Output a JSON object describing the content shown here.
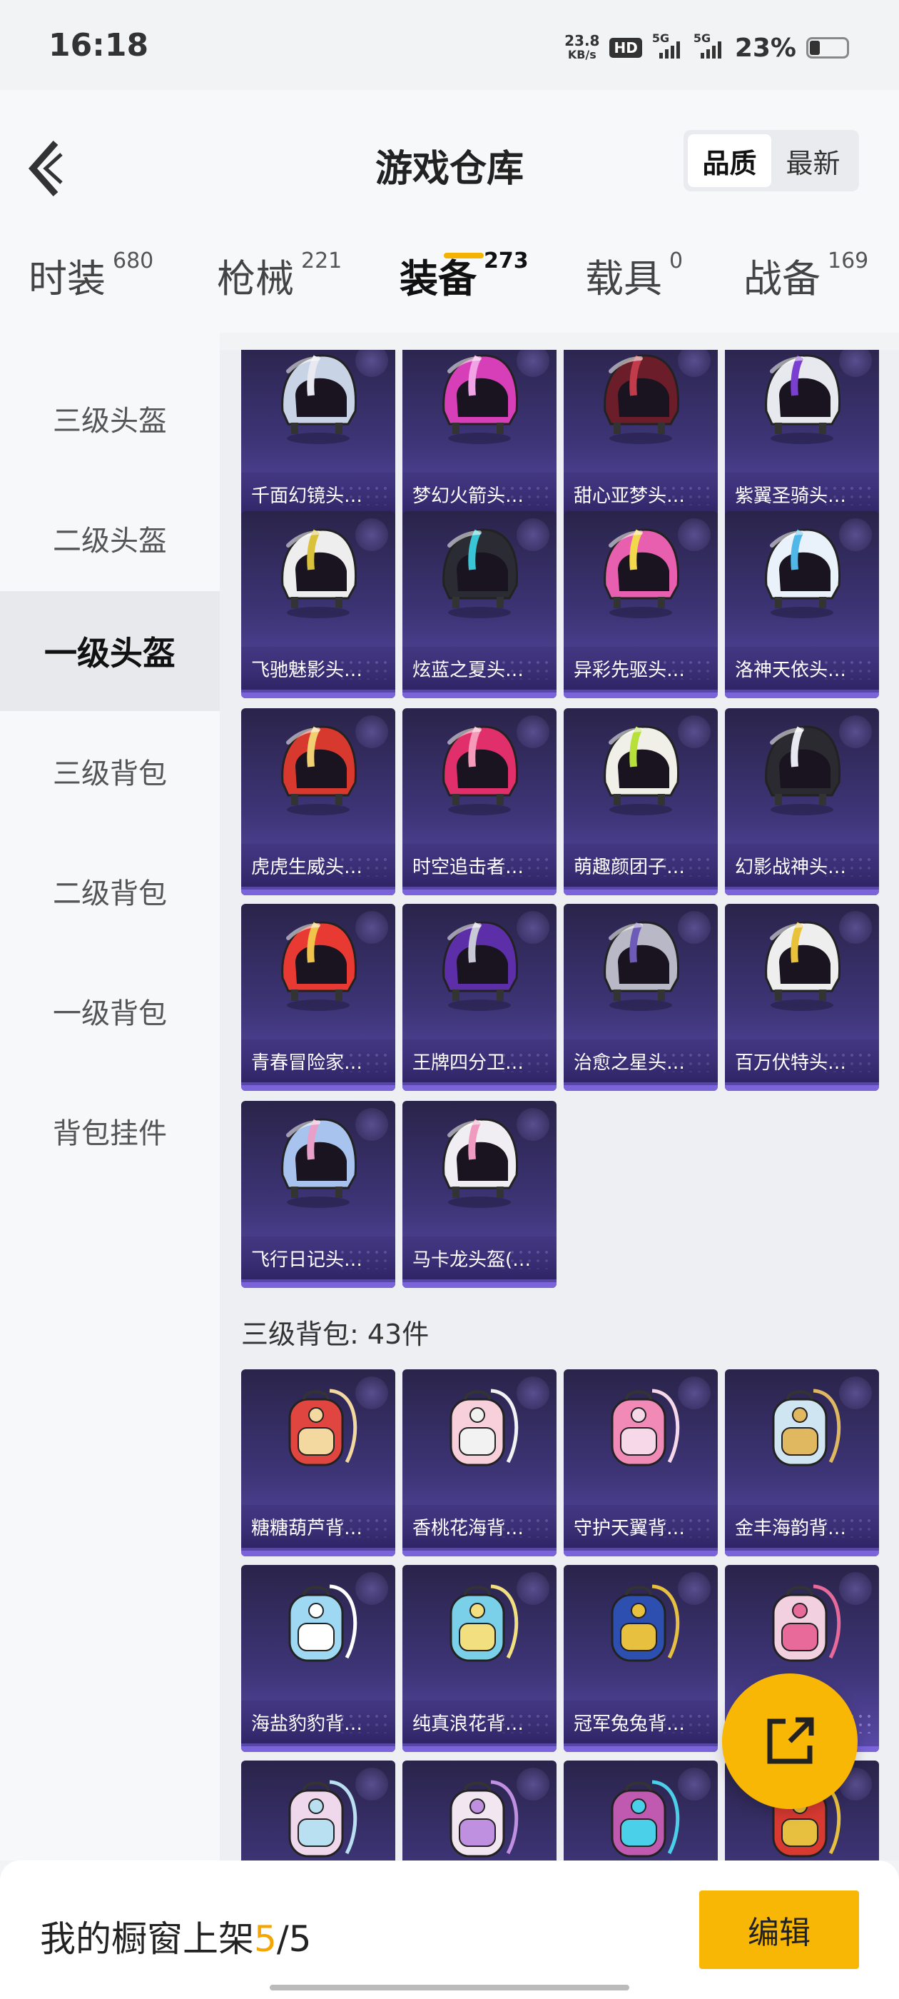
{
  "status_bar": {
    "time": "16:18",
    "net_speed_value": "23.8",
    "net_speed_unit": "KB/s",
    "hd_label": "HD",
    "signal_1": "5G",
    "signal_2": "5G",
    "battery": "23%"
  },
  "header": {
    "title": "游戏仓库",
    "sort_options": [
      {
        "label": "品质",
        "active": true
      },
      {
        "label": "最新",
        "active": false
      }
    ]
  },
  "tabs": [
    {
      "label": "时装",
      "count": "680",
      "active": false
    },
    {
      "label": "枪械",
      "count": "221",
      "active": false
    },
    {
      "label": "装备",
      "count": "273",
      "active": true
    },
    {
      "label": "载具",
      "count": "0",
      "active": false
    },
    {
      "label": "战备",
      "count": "169",
      "active": false
    }
  ],
  "sidebar": {
    "items": [
      {
        "label": "三级头盔",
        "active": false
      },
      {
        "label": "二级头盔",
        "active": false
      },
      {
        "label": "一级头盔",
        "active": true
      },
      {
        "label": "三级背包",
        "active": false
      },
      {
        "label": "二级背包",
        "active": false
      },
      {
        "label": "一级背包",
        "active": false
      },
      {
        "label": "背包挂件",
        "active": false
      }
    ]
  },
  "helmets": [
    {
      "name": "千面幻镜头…",
      "icon": "helmet-icon",
      "color": "#c9d3e6",
      "accent": "#e9e9f2"
    },
    {
      "name": "梦幻火箭头…",
      "icon": "helmet-icon",
      "color": "#d63fb7",
      "accent": "#f2a3e6"
    },
    {
      "name": "甜心亚梦头…",
      "icon": "helmet-icon",
      "color": "#6b1e2a",
      "accent": "#c23b4a"
    },
    {
      "name": "紫翼圣骑头…",
      "icon": "helmet-icon",
      "color": "#e8e8ef",
      "accent": "#7a3fd1"
    },
    {
      "name": "飞驰魅影头…",
      "icon": "helmet-icon",
      "color": "#eeeeee",
      "accent": "#d9c23a"
    },
    {
      "name": "炫蓝之夏头…",
      "icon": "helmet-icon",
      "color": "#2b2b33",
      "accent": "#38c6d6"
    },
    {
      "name": "异彩先驱头…",
      "icon": "helmet-icon",
      "color": "#e85fb0",
      "accent": "#f2d84a"
    },
    {
      "name": "洛神天依头…",
      "icon": "helmet-icon",
      "color": "#e9f2fa",
      "accent": "#4fb8e8"
    },
    {
      "name": "虎虎生威头…",
      "icon": "helmet-icon",
      "color": "#d8392f",
      "accent": "#f0d070"
    },
    {
      "name": "时空追击者…",
      "icon": "helmet-icon",
      "color": "#e02f6a",
      "accent": "#f59ab8"
    },
    {
      "name": "萌趣颜团子…",
      "icon": "helmet-icon",
      "color": "#f0f0e8",
      "accent": "#b8e03a"
    },
    {
      "name": "幻影战神头…",
      "icon": "helmet-icon",
      "color": "#2a2a30",
      "accent": "#e8e8f0"
    },
    {
      "name": "青春冒险家…",
      "icon": "helmet-icon",
      "color": "#e83a32",
      "accent": "#f2c34a"
    },
    {
      "name": "王牌四分卫…",
      "icon": "helmet-icon",
      "color": "#5c2fa8",
      "accent": "#c8c8d6"
    },
    {
      "name": "治愈之星头…",
      "icon": "helmet-icon",
      "color": "#b8b8c6",
      "accent": "#6e5ab8"
    },
    {
      "name": "百万伏特头…",
      "icon": "helmet-icon",
      "color": "#eeeeee",
      "accent": "#e8c33a"
    },
    {
      "name": "飞行日记头…",
      "icon": "helmet-icon",
      "color": "#a8c4ee",
      "accent": "#e8a0c8"
    },
    {
      "name": "马卡龙头盔(…",
      "icon": "helmet-icon",
      "color": "#f0eef2",
      "accent": "#f09ac0"
    }
  ],
  "backpack_section": {
    "label": "三级背包: 43件"
  },
  "backpacks": [
    {
      "name": "糖糖葫芦背…",
      "icon": "backpack-icon",
      "color": "#e0463f",
      "accent": "#f3d8a0"
    },
    {
      "name": "香桃花海背…",
      "icon": "backpack-icon",
      "color": "#f7d0dc",
      "accent": "#f2f2f2"
    },
    {
      "name": "守护天翼背…",
      "icon": "backpack-icon",
      "color": "#f28ab8",
      "accent": "#f7d8e8"
    },
    {
      "name": "金丰海韵背…",
      "icon": "backpack-icon",
      "color": "#cfe6f2",
      "accent": "#e0b860"
    },
    {
      "name": "海盐豹豹背…",
      "icon": "backpack-icon",
      "color": "#9fd8f2",
      "accent": "#ffffff"
    },
    {
      "name": "纯真浪花背…",
      "icon": "backpack-icon",
      "color": "#7ad0e8",
      "accent": "#f2e080"
    },
    {
      "name": "冠军兔兔背…",
      "icon": "backpack-icon",
      "color": "#2c4fb0",
      "accent": "#e8c040"
    },
    {
      "name": "",
      "icon": "backpack-icon",
      "color": "#f2d0e0",
      "accent": "#e86a9a"
    },
    {
      "name": "",
      "icon": "backpack-icon",
      "color": "#f0d8ec",
      "accent": "#b8e0f0"
    },
    {
      "name": "",
      "icon": "backpack-icon",
      "color": "#f2e6f0",
      "accent": "#c090e0"
    },
    {
      "name": "",
      "icon": "backpack-icon",
      "color": "#c05ab0",
      "accent": "#4ad0e8"
    },
    {
      "name": "",
      "icon": "backpack-icon",
      "color": "#d83a32",
      "accent": "#e8c040"
    }
  ],
  "fab": {
    "icon": "share-icon"
  },
  "bottom_bar": {
    "shelf_label": "我的橱窗上架",
    "shelf_current": "5",
    "shelf_sep": "/",
    "shelf_total": "5",
    "edit_label": "编辑"
  }
}
